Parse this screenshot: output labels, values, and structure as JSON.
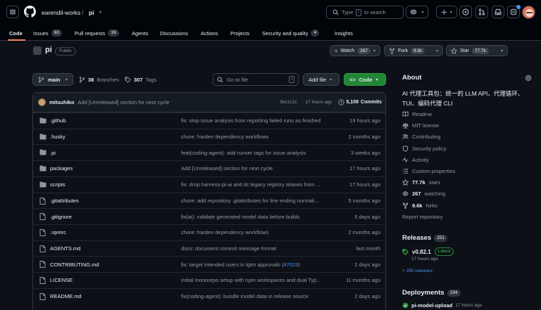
{
  "header": {
    "owner": "earendil-works",
    "separator": "/",
    "repo": "pi",
    "search_prefix": "Type",
    "search_key": "/",
    "search_suffix": "to search"
  },
  "nav": {
    "tabs": [
      {
        "label": "Code",
        "count": ""
      },
      {
        "label": "Issues",
        "count": "63"
      },
      {
        "label": "Pull requests",
        "count": "16"
      },
      {
        "label": "Agents",
        "count": ""
      },
      {
        "label": "Discussions",
        "count": ""
      },
      {
        "label": "Actions",
        "count": ""
      },
      {
        "label": "Projects",
        "count": ""
      },
      {
        "label": "Security and quality",
        "count": "4"
      },
      {
        "label": "Insights",
        "count": ""
      }
    ]
  },
  "repo": {
    "name": "pi",
    "visibility": "Public",
    "watch_label": "Watch",
    "watch_count": "267",
    "fork_label": "Fork",
    "fork_count": "9.6k",
    "star_label": "Star",
    "star_count": "77.7k"
  },
  "toolbar": {
    "branch": "main",
    "branches_count": "38",
    "branches_label": "Branches",
    "tags_count": "307",
    "tags_label": "Tags",
    "goto_placeholder": "Go to file",
    "goto_key": "t",
    "add_file": "Add file",
    "code": "Code"
  },
  "commit": {
    "author": "mitsuhiko",
    "message": "Add [Unreleased] section for next cycle",
    "hash": "5bc1c2c",
    "time": "· 17 hours ago",
    "commits_count": "5,109",
    "commits_label": "Commits"
  },
  "files": [
    {
      "name": ".github",
      "type": "dir",
      "message": "fix: stop issue analysis from reporting failed runs as finished",
      "time": "19 hours ago"
    },
    {
      "name": ".husky",
      "type": "dir",
      "message": "chore: harden dependency workflows",
      "time": "2 months ago"
    },
    {
      "name": ".pi",
      "type": "dir",
      "message": "feat(coding-agent): add runner tags for issue analysis",
      "time": "3 weeks ago"
    },
    {
      "name": "packages",
      "type": "dir",
      "message": "Add [Unreleased] section for next cycle",
      "time": "17 hours ago"
    },
    {
      "name": "scripts",
      "type": "dir",
      "message": "fix: drop harness-pi-ai and its legacy registry aliases from ...",
      "time": "17 hours ago"
    },
    {
      "name": ".gitattributes",
      "type": "file",
      "message": "chore: add repository .gitattributes for line ending normali...",
      "time": "5 months ago"
    },
    {
      "name": ".gitignore",
      "type": "file",
      "message": "fix(ai): validate generated model data before builds",
      "time": "5 days ago"
    },
    {
      "name": ".npmrc",
      "type": "file",
      "message": "chore: harden dependency workflows",
      "time": "2 months ago"
    },
    {
      "name": "AGENTS.md",
      "type": "file",
      "message": "docs: document commit message format",
      "time": "last month"
    },
    {
      "name": "CONTRIBUTING.md",
      "type": "file",
      "message": "fix: target intended users in lgtm approvals (",
      "link": "#7023",
      "message_end": ")",
      "time": "2 days ago"
    },
    {
      "name": "LICENSE",
      "type": "file",
      "message": "Initial monorepo setup with npm workspaces and dual Typ...",
      "time": "11 months ago"
    },
    {
      "name": "README.md",
      "type": "file",
      "message": "fix(coding-agent): bundle model data in release source",
      "time": "2 days ago"
    }
  ],
  "about": {
    "heading": "About",
    "description": "AI 代理工具包：统一的 LLM API、代理循环、TUI、编码代理 CLI",
    "links": [
      {
        "icon": "book-icon",
        "label": "Readme",
        "bold": ""
      },
      {
        "icon": "law-icon",
        "label": "MIT license",
        "bold": ""
      },
      {
        "icon": "people-icon",
        "label": "Contributing",
        "bold": ""
      },
      {
        "icon": "shield-icon",
        "label": "Security policy",
        "bold": ""
      },
      {
        "icon": "pulse-icon",
        "label": "Activity",
        "bold": ""
      },
      {
        "icon": "list-icon",
        "label": "Custom properties",
        "bold": ""
      },
      {
        "icon": "star-icon",
        "label": "stars",
        "bold": "77.7k"
      },
      {
        "icon": "eye-icon",
        "label": "watching",
        "bold": "267"
      },
      {
        "icon": "fork-icon",
        "label": "forks",
        "bold": "9.6k"
      },
      {
        "icon": "",
        "label": "Report repository",
        "bold": ""
      }
    ]
  },
  "releases": {
    "heading": "Releases",
    "count": "251",
    "latest_tag": "v0.82.1",
    "latest_badge": "Latest",
    "latest_time": "17 hours ago",
    "more": "+ 250 releases"
  },
  "deployments": {
    "heading": "Deployments",
    "count": "194",
    "item": "pi-model-upload",
    "time": "17 hours ago"
  },
  "colors": {
    "background": "#0d1117",
    "header": "#010409",
    "accent_green": "#238636",
    "link_blue": "#4493f8",
    "tab_underline": "#f78166"
  }
}
